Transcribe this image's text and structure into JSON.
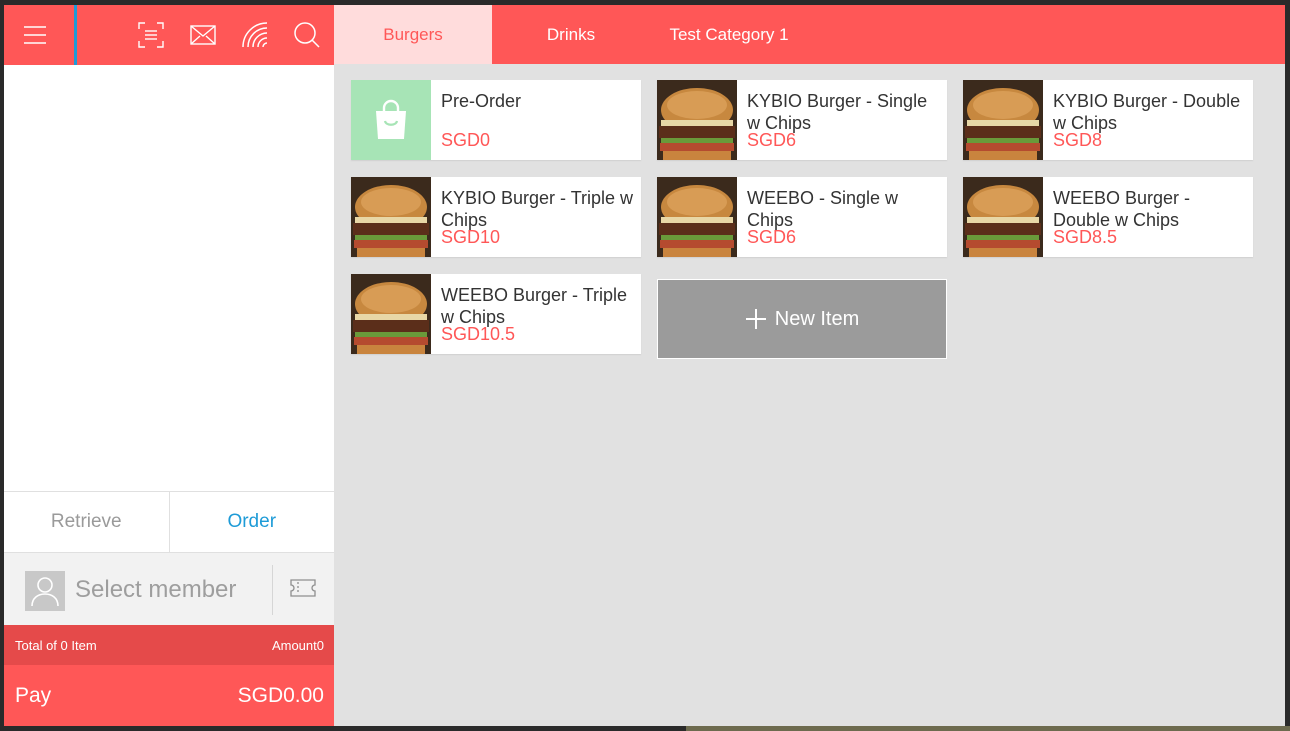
{
  "colors": {
    "accent": "#ff5757",
    "accent_dark": "#e54a4a",
    "link": "#1e9bd7",
    "highlight": "#1e9bd7"
  },
  "topbar": {
    "icons": [
      "menu-icon",
      "scan-icon",
      "mail-icon",
      "nfc-icon",
      "search-icon"
    ]
  },
  "actions": {
    "retrieve": "Retrieve",
    "order": "Order"
  },
  "member": {
    "label": "Select member"
  },
  "summary": {
    "total_items": "Total of 0 Item",
    "amount": "Amount0"
  },
  "pay": {
    "label": "Pay",
    "amount": "SGD0.00"
  },
  "tabs": [
    {
      "label": "Burgers",
      "active": true
    },
    {
      "label": "Drinks",
      "active": false
    },
    {
      "label": "Test Category 1",
      "active": false
    }
  ],
  "products": [
    {
      "name": "Pre-Order",
      "price": "SGD0",
      "icon": "shopping-bag-icon"
    },
    {
      "name": "KYBIO Burger - Single w Chips",
      "price": "SGD6",
      "icon": "burger-image"
    },
    {
      "name": "KYBIO Burger - Double w Chips",
      "price": "SGD8",
      "icon": "burger-image"
    },
    {
      "name": "KYBIO Burger - Triple w Chips",
      "price": "SGD10",
      "icon": "burger-image"
    },
    {
      "name": "WEEBO - Single w Chips",
      "price": "SGD6",
      "icon": "burger-image"
    },
    {
      "name": "WEEBO Burger - Double w Chips",
      "price": "SGD8.5",
      "icon": "burger-image"
    },
    {
      "name": "WEEBO Burger - Triple w Chips",
      "price": "SGD10.5",
      "icon": "burger-image"
    }
  ],
  "new_item": {
    "label": "New Item"
  }
}
